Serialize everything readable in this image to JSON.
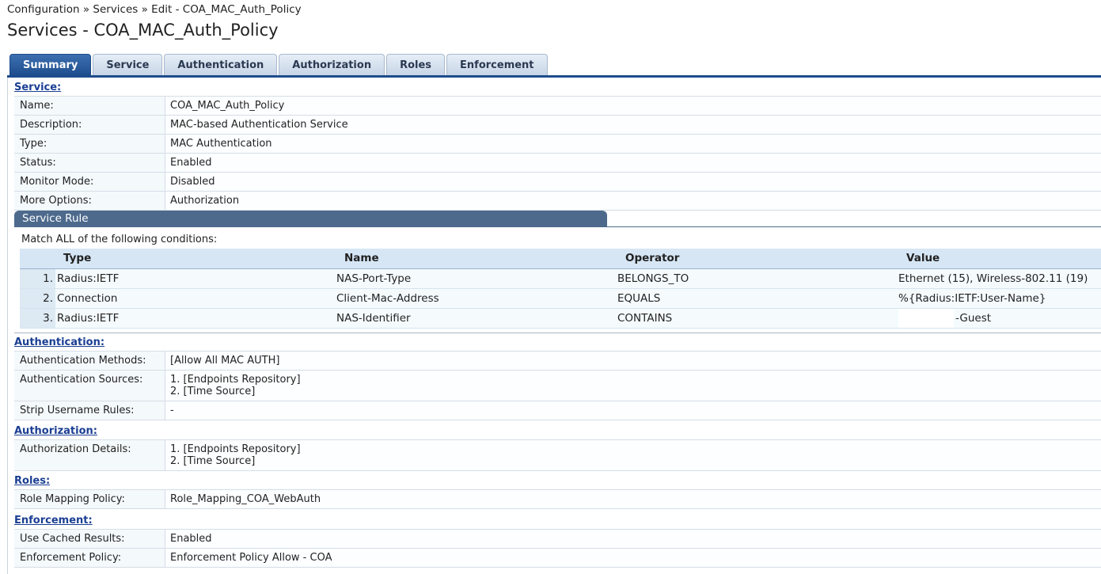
{
  "breadcrumb": "Configuration » Services » Edit - COA_MAC_Auth_Policy",
  "page_title": "Services - COA_MAC_Auth_Policy",
  "tabs": [
    "Summary",
    "Service",
    "Authentication",
    "Authorization",
    "Roles",
    "Enforcement"
  ],
  "active_tab": "Summary",
  "service": {
    "heading": "Service:",
    "rows": [
      {
        "label": "Name:",
        "value": "COA_MAC_Auth_Policy"
      },
      {
        "label": "Description:",
        "value": "MAC-based Authentication Service"
      },
      {
        "label": "Type:",
        "value": "MAC Authentication"
      },
      {
        "label": "Status:",
        "value": "Enabled"
      },
      {
        "label": "Monitor Mode:",
        "value": "Disabled"
      },
      {
        "label": "More Options:",
        "value": "Authorization"
      }
    ]
  },
  "service_rule": {
    "title": "Service Rule",
    "intro": "Match ALL of the following conditions:",
    "columns": [
      "Type",
      "Name",
      "Operator",
      "Value"
    ],
    "rows": [
      {
        "num": "1.",
        "type": "Radius:IETF",
        "name": "NAS-Port-Type",
        "operator": "BELONGS_TO",
        "value": "Ethernet (15), Wireless-802.11 (19)"
      },
      {
        "num": "2.",
        "type": "Connection",
        "name": "Client-Mac-Address",
        "operator": "EQUALS",
        "value": "%{Radius:IETF:User-Name}"
      },
      {
        "num": "3.",
        "type": "Radius:IETF",
        "name": "NAS-Identifier",
        "operator": "CONTAINS",
        "value": "-Guest"
      }
    ]
  },
  "authentication": {
    "heading": "Authentication:",
    "rows": [
      {
        "label": "Authentication Methods:",
        "value": "[Allow All MAC AUTH]"
      },
      {
        "label": "Authentication Sources:",
        "value": "1. [Endpoints Repository]\n2. [Time Source]"
      },
      {
        "label": "Strip Username Rules:",
        "value": "-"
      }
    ]
  },
  "authorization": {
    "heading": "Authorization:",
    "rows": [
      {
        "label": "Authorization Details:",
        "value": "1. [Endpoints Repository]\n2. [Time Source]"
      }
    ]
  },
  "roles": {
    "heading": "Roles:",
    "rows": [
      {
        "label": "Role Mapping Policy:",
        "value": "Role_Mapping_COA_WebAuth"
      }
    ]
  },
  "enforcement": {
    "heading": "Enforcement:",
    "rows": [
      {
        "label": "Use Cached Results:",
        "value": "Enabled"
      },
      {
        "label": "Enforcement Policy:",
        "value": "Enforcement Policy Allow - COA"
      }
    ]
  },
  "colors": {
    "accent": "#1d4c8c",
    "section_link": "#1b3f93",
    "rule_header": "#4d6a8c"
  }
}
